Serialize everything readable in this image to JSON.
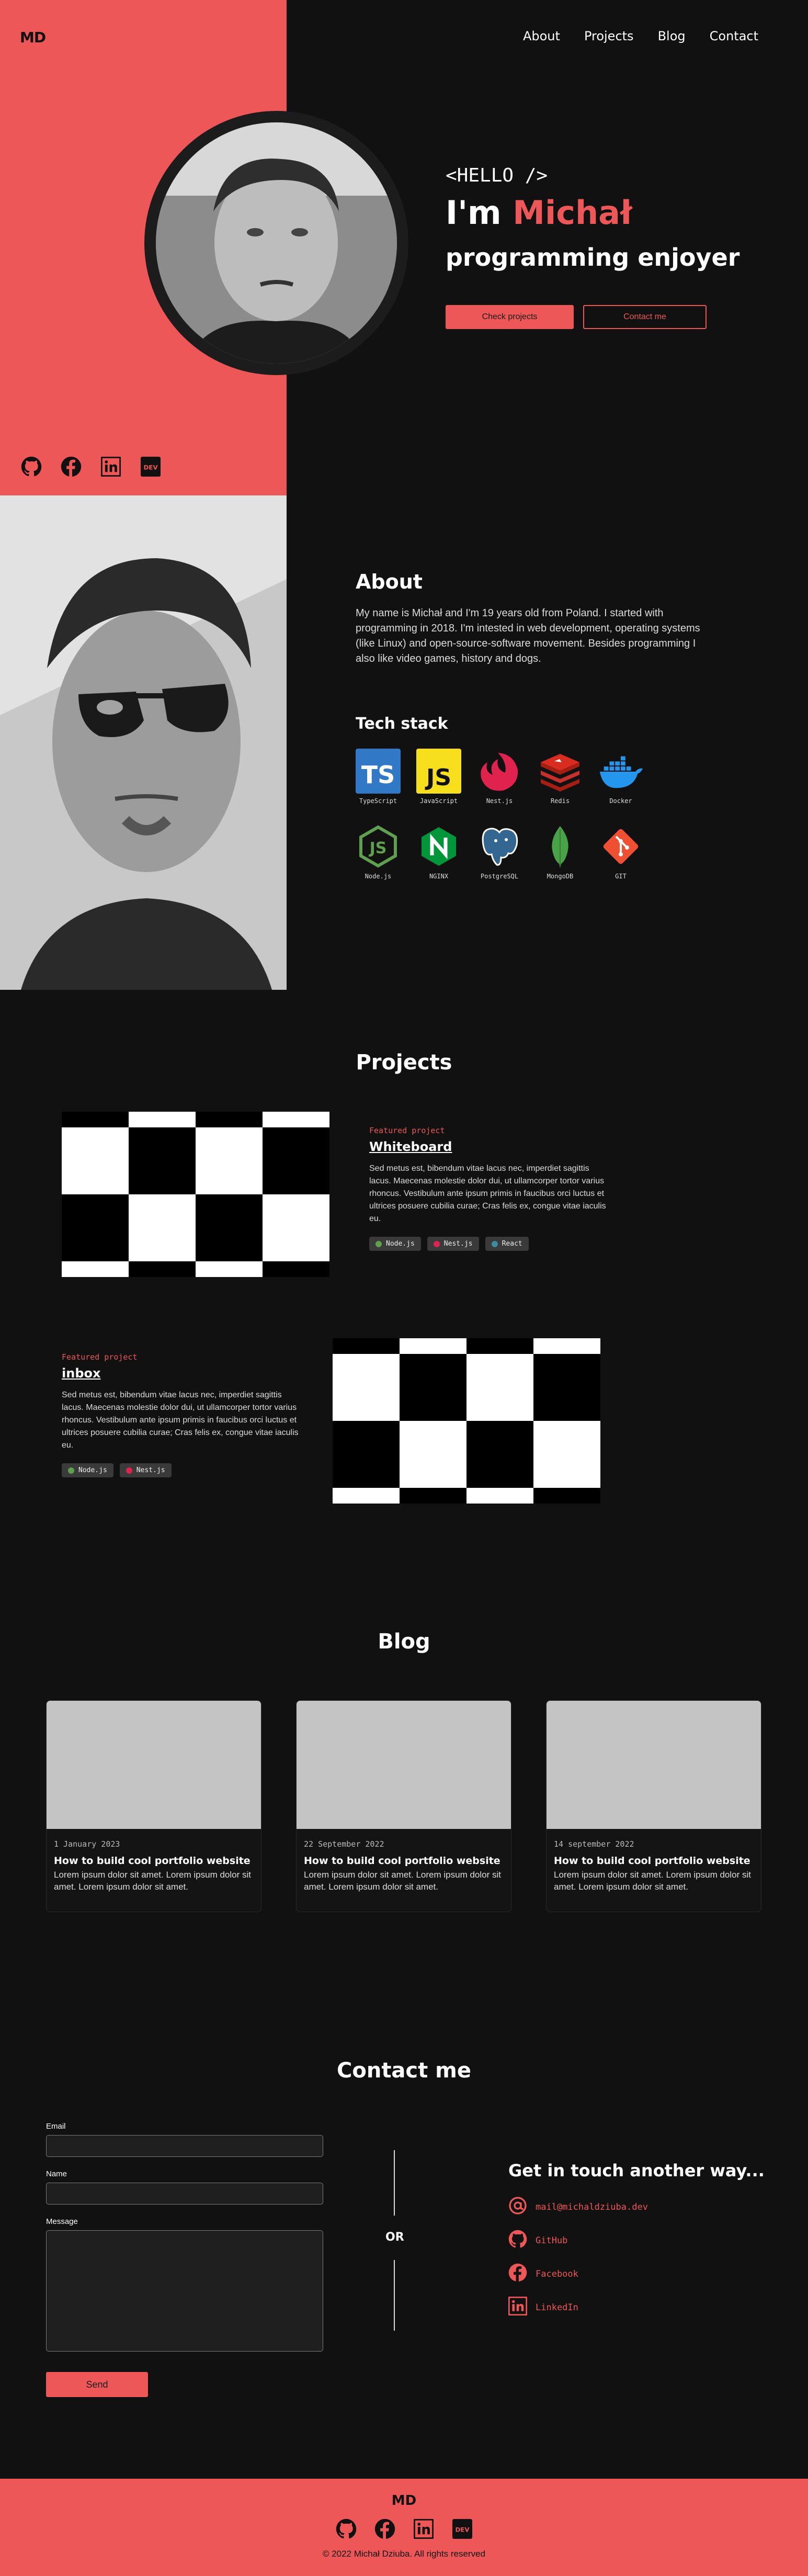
{
  "colors": {
    "accent": "#ee5757",
    "background": "#111111",
    "card_image": "#c4c4c4"
  },
  "header": {
    "logo": "MD",
    "nav": [
      "About",
      "Projects",
      "Blog",
      "Contact"
    ]
  },
  "hero": {
    "hello": "<HELLO />",
    "greeting": "I'm",
    "name": "Michał",
    "tagline": "programming enjoyer",
    "primary_button": "Check projects",
    "secondary_button": "Contact me",
    "socials": [
      "github-icon",
      "facebook-icon",
      "linkedin-icon",
      "dev-icon"
    ]
  },
  "about": {
    "title": "About",
    "text": "My name is Michał and I'm 19 years old from Poland. I started with programming in 2018. I'm intested in web development, operating systems (like Linux) and open-source-software movement. Besides programming I also like video games, history and dogs.",
    "tech_title": "Tech stack",
    "tech": [
      {
        "name": "TypeScript",
        "icon": "typescript-icon"
      },
      {
        "name": "JavaScript",
        "icon": "javascript-icon"
      },
      {
        "name": "Nest.js",
        "icon": "nestjs-icon"
      },
      {
        "name": "Redis",
        "icon": "redis-icon"
      },
      {
        "name": "Docker",
        "icon": "docker-icon"
      },
      {
        "name": "Node.js",
        "icon": "nodejs-icon"
      },
      {
        "name": "NGINX",
        "icon": "nginx-icon"
      },
      {
        "name": "PostgreSQL",
        "icon": "postgresql-icon"
      },
      {
        "name": "MongoDB",
        "icon": "mongodb-icon"
      },
      {
        "name": "GIT",
        "icon": "git-icon"
      }
    ]
  },
  "projects": {
    "title": "Projects",
    "items": [
      {
        "featured": "Featured project",
        "name": "Whiteboard",
        "description": "Sed metus est, bibendum vitae lacus nec, imperdiet sagittis lacus. Maecenas molestie dolor dui, ut ullamcorper tortor varius rhoncus. Vestibulum ante ipsum primis in faucibus orci luctus et ultrices posuere cubilia curae; Cras felis ex, congue vitae iaculis eu.",
        "tags": [
          "Node.js",
          "Nest.js",
          "React"
        ]
      },
      {
        "featured": "Featured project",
        "name": "inbox",
        "description": "Sed metus est, bibendum vitae lacus nec, imperdiet sagittis lacus. Maecenas molestie dolor dui, ut ullamcorper tortor varius rhoncus. Vestibulum ante ipsum primis in faucibus orci luctus et ultrices posuere cubilia curae; Cras felis ex, congue vitae iaculis eu.",
        "tags": [
          "Node.js",
          "Nest.js"
        ]
      }
    ]
  },
  "blog": {
    "title": "Blog",
    "posts": [
      {
        "date": "1 January 2023",
        "title": "How to build cool portfolio website",
        "text": "Lorem ipsum dolor sit amet. Lorem ipsum dolor sit amet. Lorem ipsum dolor sit amet."
      },
      {
        "date": "22 September 2022",
        "title": "How to build cool portfolio website",
        "text": "Lorem ipsum dolor sit amet. Lorem ipsum dolor sit amet. Lorem ipsum dolor sit amet."
      },
      {
        "date": "14 september 2022",
        "title": "How to build cool portfolio website",
        "text": "Lorem ipsum dolor sit amet. Lorem ipsum dolor sit amet. Lorem ipsum dolor sit amet."
      }
    ]
  },
  "contact": {
    "title": "Contact me",
    "email_label": "Email",
    "name_label": "Name",
    "message_label": "Message",
    "send_label": "Send",
    "or": "OR",
    "other_title": "Get in touch another way...",
    "links": [
      {
        "icon": "at-icon",
        "label": "mail@michaldziuba.dev"
      },
      {
        "icon": "github-icon",
        "label": "GitHub"
      },
      {
        "icon": "facebook-icon",
        "label": "Facebook"
      },
      {
        "icon": "linkedin-icon",
        "label": "LinkedIn"
      }
    ]
  },
  "footer": {
    "logo": "MD",
    "copyright": "© 2022 Michał Dziuba. All rights reserved"
  }
}
